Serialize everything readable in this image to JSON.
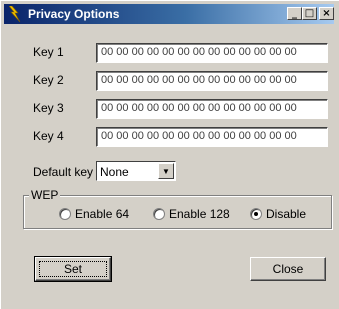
{
  "window": {
    "title": "Privacy Options",
    "controls": {
      "minimize": "_",
      "maximize": "□",
      "close": "×"
    }
  },
  "keys": [
    {
      "label": "Key 1",
      "value": "00 00 00 00 00 00 00 00 00 00 00 00 00"
    },
    {
      "label": "Key 2",
      "value": "00 00 00 00 00 00 00 00 00 00 00 00 00"
    },
    {
      "label": "Key 3",
      "value": "00 00 00 00 00 00 00 00 00 00 00 00 00"
    },
    {
      "label": "Key 4",
      "value": "00 00 00 00 00 00 00 00 00 00 00 00 00"
    }
  ],
  "default_key": {
    "label": "Default key",
    "value": "None"
  },
  "wep": {
    "legend": "WEP",
    "options": [
      {
        "label": "Enable 64",
        "selected": false
      },
      {
        "label": "Enable 128",
        "selected": false
      },
      {
        "label": "Disable",
        "selected": true
      }
    ]
  },
  "buttons": {
    "set": "Set",
    "close": "Close"
  },
  "icons": {
    "app": "lightning-bolt-icon"
  },
  "colors": {
    "titlebar_start": "#0a246a",
    "titlebar_end": "#a6caf0",
    "face": "#d4d0c8"
  }
}
